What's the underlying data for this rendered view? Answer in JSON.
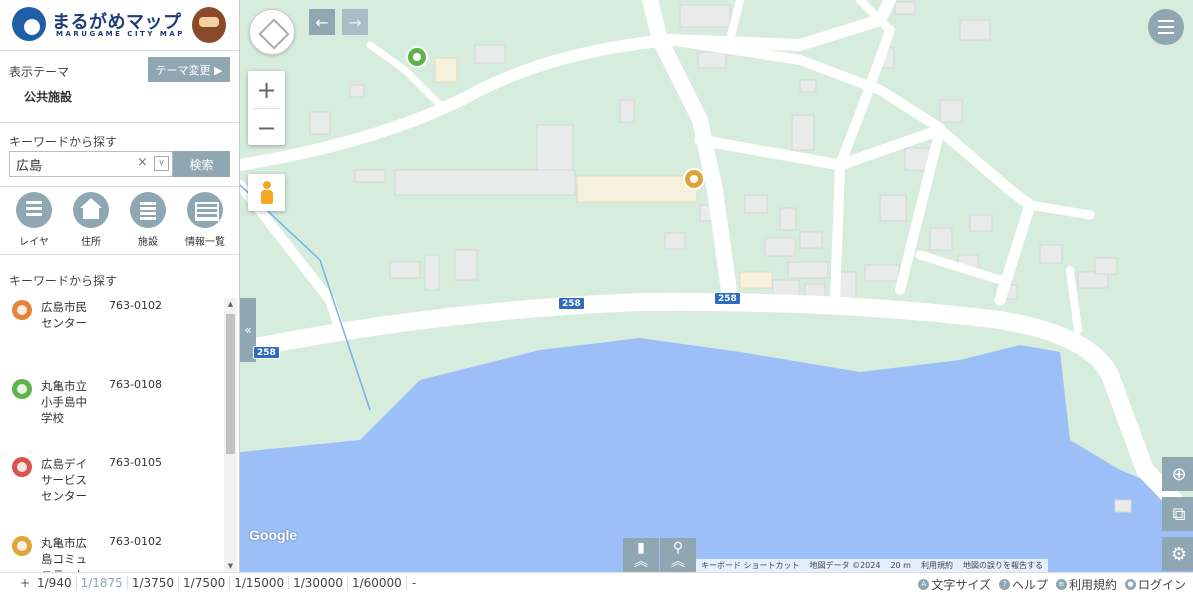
{
  "header": {
    "logo_title": "まるがめマップ",
    "logo_subtitle": "MARUGAME CITY MAP"
  },
  "theme": {
    "label": "表示テーマ",
    "change_button": "テーマ変更 ▶",
    "value": "公共施設"
  },
  "keyword_search": {
    "label": "キーワードから探す",
    "input_value": "広島",
    "clear_icon": "×",
    "dropdown_icon": "∨",
    "search_button": "検索"
  },
  "nav": [
    {
      "label": "レイヤ",
      "icon": "layers-icon"
    },
    {
      "label": "住所",
      "icon": "home-icon"
    },
    {
      "label": "施設",
      "icon": "building-icon"
    },
    {
      "label": "情報一覧",
      "icon": "info-list-icon"
    }
  ],
  "results": {
    "label": "キーワードから探す",
    "items": [
      {
        "name": "広島市民センター",
        "zip": "763-0102",
        "color": "#e8823a"
      },
      {
        "name": "丸亀市立小手島中学校",
        "zip": "763-0108",
        "color": "#5fb34a"
      },
      {
        "name": "広島デイサービスセンター",
        "zip": "763-0105",
        "color": "#d9534f"
      },
      {
        "name": "丸亀市広島コミュニティセ",
        "zip": "763-0102",
        "color": "#e0a43a"
      }
    ]
  },
  "map": {
    "road_badges": [
      "258",
      "258",
      "258",
      "2"
    ],
    "google_logo": "Google",
    "collapse_icon": "«",
    "back_icon": "←",
    "forward_icon": "→",
    "zoom_in": "+",
    "zoom_out": "−",
    "side_tools": [
      "⊕",
      "⧉",
      "⚙"
    ],
    "bottom_tools": [
      "︽",
      "︽"
    ],
    "attribution": [
      "キーボード ショートカット",
      "地図データ ©2024",
      "20 m",
      "利用規約",
      "地図の誤りを報告する"
    ],
    "colors": {
      "land": "#d6ecdd",
      "water": "#9dbff7",
      "road": "#ffffff",
      "building": "#e8ebe9",
      "accent": "#8fa7b3"
    }
  },
  "footer": {
    "plus": "+",
    "scales": [
      "1/940",
      "1/1875",
      "1/3750",
      "1/7500",
      "1/15000",
      "1/30000",
      "1/60000"
    ],
    "active_scale": "1/1875",
    "minus": "-",
    "links": [
      {
        "icon": "A",
        "label": "文字サイズ"
      },
      {
        "icon": "?",
        "label": "ヘルプ"
      },
      {
        "icon": "≡",
        "label": "利用規約"
      },
      {
        "icon": "●",
        "label": "ログイン"
      }
    ]
  }
}
